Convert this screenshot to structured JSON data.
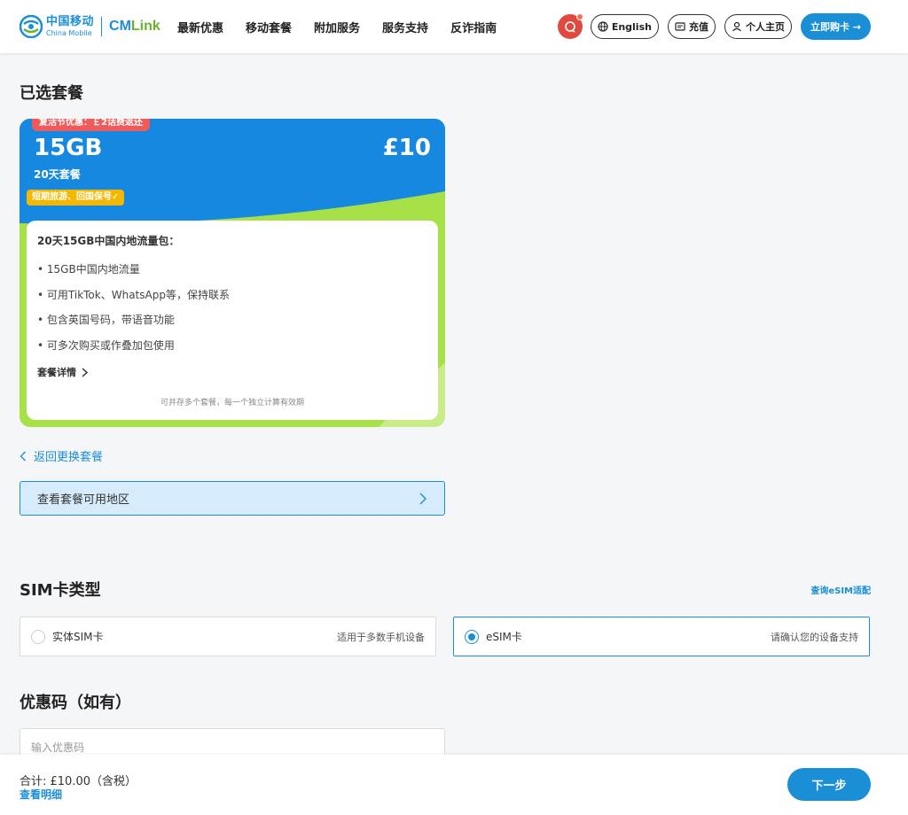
{
  "header": {
    "logo_cn": "中国移动",
    "logo_en": "China Mobile",
    "logo_cmlink_prefix": "CM",
    "logo_cmlink_suffix": "Link",
    "nav": [
      "最新优惠",
      "移动套餐",
      "附加服务",
      "服务支持",
      "反诈指南"
    ],
    "language_label": "English",
    "topup_label": "充值",
    "account_label": "个人主页",
    "buy_label": "立即购卡 →"
  },
  "selected_plan": {
    "section_title": "已选套餐",
    "promo_tag": "复活节优惠：￡2话费返还",
    "data": "15GB",
    "duration": "20天套餐",
    "price": "£10",
    "badge": "短期旅游、回国保号✓",
    "body_heading": "20天15GB中国内地流量包：",
    "features": [
      "• 15GB中国内地流量",
      "• 可用TikTok、WhatsApp等，保持联系",
      "• 包含英国号码，带语音功能",
      "• 可多次购买或作叠加包使用"
    ],
    "details_link": "套餐详情",
    "note": "可并存多个套餐，每一个独立计算有效期",
    "colors": {
      "top": "#1788e0",
      "accent": "#a8e048",
      "badge": "#f5b800",
      "promo": "#f05a5a"
    }
  },
  "back_link": "返回更换套餐",
  "region_button": "查看套餐可用地区",
  "sim_type": {
    "section_title": "SIM卡类型",
    "esim_check_link": "查询eSIM适配",
    "options": [
      {
        "label": "实体SIM卡",
        "note": "适用于多数手机设备",
        "selected": false
      },
      {
        "label": "eSIM卡",
        "note": "请确认您的设备支持",
        "selected": true
      }
    ]
  },
  "promo_code": {
    "section_title": "优惠码（如有）",
    "placeholder": "输入优惠码"
  },
  "footer": {
    "total": "合计: £10.00（含税）",
    "view_details": "查看明细",
    "next_label": "下一步"
  },
  "brand_color": "#1a8fd6"
}
